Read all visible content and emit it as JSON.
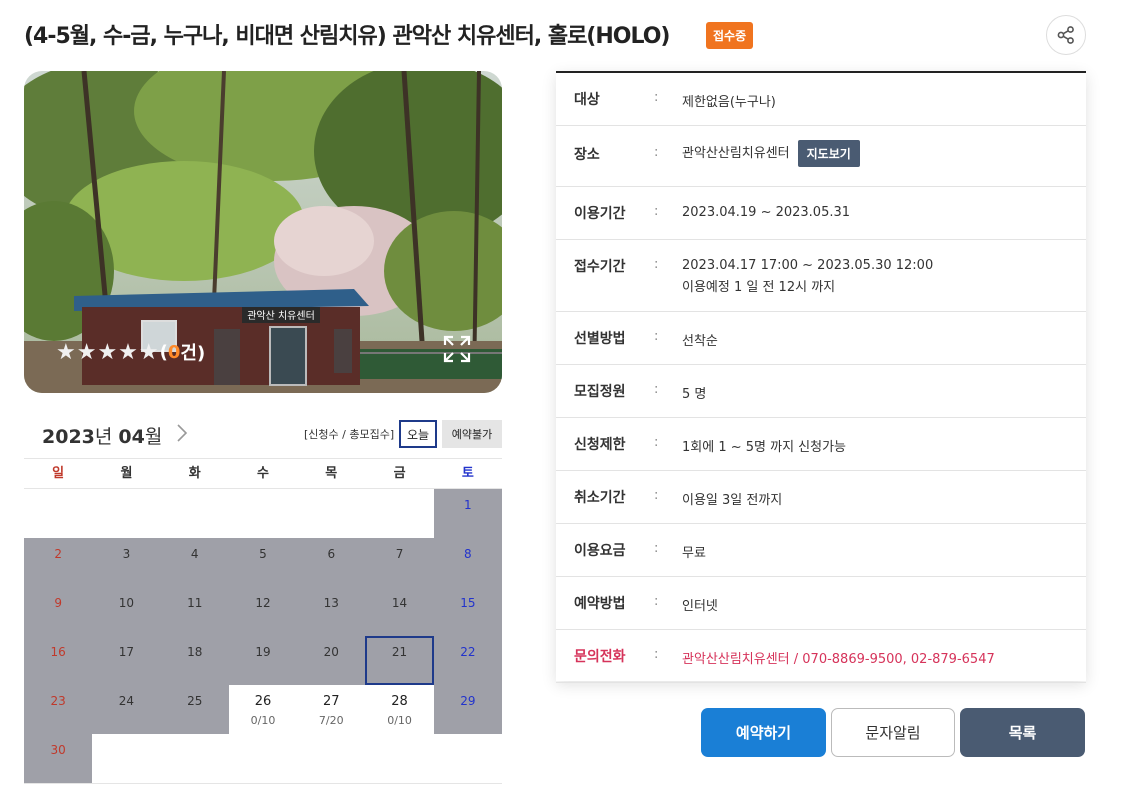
{
  "header": {
    "title": "(4-5월, 수-금, 누구나, 비대면 산림치유) 관악산 치유센터, 홀로(HOLO)",
    "status": "접수중",
    "share_icon": "share-icon"
  },
  "photo": {
    "sign_text": "관악산 치유센터",
    "rating_stars": "★★★★★",
    "rating_open": "(",
    "rating_count": "0",
    "rating_close": " 건)",
    "expand_icon": "expand-icon"
  },
  "calendar": {
    "year": "2023",
    "year_unit": "년",
    "month": "04",
    "month_unit": "월",
    "legend_text": "[신청수 / 총모집수]",
    "legend_today": "오늘",
    "legend_closed": "예약불가",
    "weekdays": [
      "일",
      "월",
      "화",
      "수",
      "목",
      "금",
      "토"
    ],
    "weeks": [
      [
        {
          "day": "",
          "state": "blank"
        },
        {
          "day": "",
          "state": "blank"
        },
        {
          "day": "",
          "state": "blank"
        },
        {
          "day": "",
          "state": "blank"
        },
        {
          "day": "",
          "state": "blank"
        },
        {
          "day": "",
          "state": "blank"
        },
        {
          "day": "1",
          "state": "disabled"
        }
      ],
      [
        {
          "day": "2",
          "state": "disabled"
        },
        {
          "day": "3",
          "state": "disabled"
        },
        {
          "day": "4",
          "state": "disabled"
        },
        {
          "day": "5",
          "state": "disabled"
        },
        {
          "day": "6",
          "state": "disabled"
        },
        {
          "day": "7",
          "state": "disabled"
        },
        {
          "day": "8",
          "state": "disabled"
        }
      ],
      [
        {
          "day": "9",
          "state": "disabled"
        },
        {
          "day": "10",
          "state": "disabled"
        },
        {
          "day": "11",
          "state": "disabled"
        },
        {
          "day": "12",
          "state": "disabled"
        },
        {
          "day": "13",
          "state": "disabled"
        },
        {
          "day": "14",
          "state": "disabled"
        },
        {
          "day": "15",
          "state": "disabled"
        }
      ],
      [
        {
          "day": "16",
          "state": "disabled"
        },
        {
          "day": "17",
          "state": "disabled"
        },
        {
          "day": "18",
          "state": "disabled"
        },
        {
          "day": "19",
          "state": "disabled"
        },
        {
          "day": "20",
          "state": "disabled"
        },
        {
          "day": "21",
          "state": "today"
        },
        {
          "day": "22",
          "state": "disabled"
        }
      ],
      [
        {
          "day": "23",
          "state": "disabled"
        },
        {
          "day": "24",
          "state": "disabled"
        },
        {
          "day": "25",
          "state": "disabled"
        },
        {
          "day": "26",
          "state": "available",
          "slot": "0/10"
        },
        {
          "day": "27",
          "state": "available",
          "slot": "7/20"
        },
        {
          "day": "28",
          "state": "available",
          "slot": "0/10"
        },
        {
          "day": "29",
          "state": "disabled"
        }
      ],
      [
        {
          "day": "30",
          "state": "disabled"
        },
        {
          "day": "",
          "state": "blank"
        },
        {
          "day": "",
          "state": "blank"
        },
        {
          "day": "",
          "state": "blank"
        },
        {
          "day": "",
          "state": "blank"
        },
        {
          "day": "",
          "state": "blank"
        },
        {
          "day": "",
          "state": "blank"
        }
      ]
    ]
  },
  "info": [
    {
      "label": "대상",
      "value": "제한없음(누구나)"
    },
    {
      "label": "장소",
      "value": "관악산산림치유센터",
      "button": "지도보기"
    },
    {
      "label": "이용기간",
      "value": "2023.04.19 ~ 2023.05.31"
    },
    {
      "label": "접수기간",
      "value": "2023.04.17 17:00 ~ 2023.05.30 12:00",
      "value2": "이용예정 1 일 전 12시 까지"
    },
    {
      "label": "선별방법",
      "value": "선착순"
    },
    {
      "label": "모집정원",
      "value": "5 명"
    },
    {
      "label": "신청제한",
      "value": "1회에 1 ~ 5명 까지 신청가능"
    },
    {
      "label": "취소기간",
      "value": "이용일 3일 전까지"
    },
    {
      "label": "이용요금",
      "value": "무료"
    },
    {
      "label": "예약방법",
      "value": "인터넷"
    },
    {
      "label": "문의전화",
      "value": "관악산산림치유센터 / 070-8869-9500, 02-879-6547",
      "highlight": true
    }
  ],
  "info_colon": ":",
  "buttons": {
    "reserve": "예약하기",
    "sms": "문자알림",
    "list": "목록"
  },
  "colors": {
    "status_badge": "#f0741f",
    "reserve_button": "#1a7fd6",
    "list_button": "#4a5b72",
    "contact_text": "#d6335a"
  }
}
